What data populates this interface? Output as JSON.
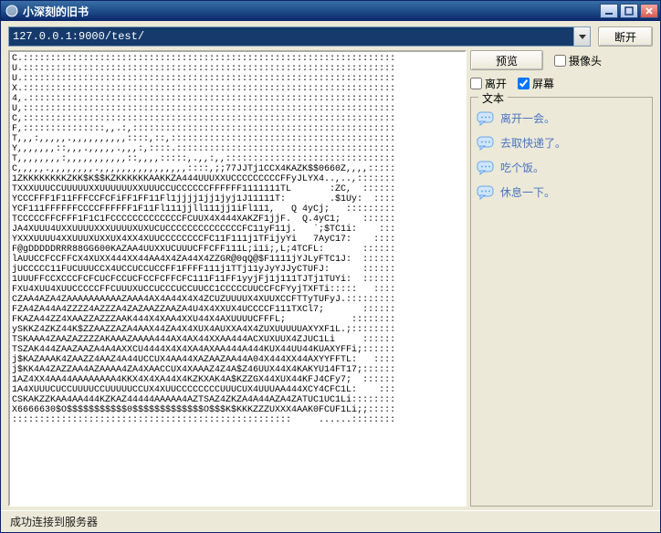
{
  "window": {
    "title": "小深刻的旧书"
  },
  "address": {
    "value": "127.0.0.1:9000/test/"
  },
  "buttons": {
    "disconnect": "断开",
    "preview": "预览"
  },
  "checkboxes": {
    "camera": "摄像头",
    "leave": "离开",
    "screen": "屏幕"
  },
  "checkbox_state": {
    "camera": false,
    "leave": false,
    "screen": true
  },
  "group": {
    "title": "文本"
  },
  "messages": [
    "离开一会。",
    "去取快递了。",
    "吃个饭。",
    "休息一下。"
  ],
  "ascii": "C.::::::::::::::::::::::::::::::::::::::::::::::::::::::::::::::::::::\nU.::::::::::::::::::::::::::::::::::::::::::::::::::::::::::::::::::::\nU.::::::::::::::::::::::::::::::::::::::::::::::::::::::::::::::::::::\nX.::::::::::::::::::::::::::::::::::::::::::::::::::::::::::::::::::::\n4,.:::::::::::::::::::::::::::::::::::::::::::::::::::::::::::::::::::\nU,::::::::::::::::::::::::::::::::::::::::::::::::::::::::::::::::::::\nC,::::::::::::::::::::::::::::::::::::::::::::::::::::::::::::::::::::\nF,:::::::::::::::,,.:,::::::::::::::::::::::::::::::::::::::::::::::::\nT,,,:,,,,,.,,,,,,,,,,::::,::,:::::::::::::::::::::::::::::::::::::::::\nY,,,,,,,::,,,.,,,,,.,,,:,::::.::::::::::::::::::::::::::::::::::::::::\nT,,,,,,,,:,,,,,,,,,,,::,,,,:::::,.,,:,,:::::::::::::::::::::::::::::::\nC,,,,,.,,,,,,,,.,,,,,,,,,,,,,,,,::::,;;77JJTj1CCX4KAZK$$0660Z,,,,:::::\n1ZKKKKKKKKZKK$K$$KZKKKKKKAAKKZA444UUUXXUCCCCCCCCCFFyJLYX4..,..,:::::::\nTXXXUUUCCUUUUUXXUUUUUUXXUUUCCUCCCCCCFFFFFF1111111TL       :ZC,  ::::::\nYCCCFFF1F11FFFCCFCFiFF1FF11Fl1jjjj1jj1jyj1J11111T:        .$1Uy:  ::::\nYCF111FFFFFFCCCCFFFFFF1F11Fl111jjll111jj1iFl111,   Q 4yCj;   :::::::::\nTCCCCCFFCFFF1F1C1FCCCCCCCCCCCCCFCUUX4X444XAKZF1jjF.  Q.4yC1;    ::::::\nJA4XUUU4UXXUUUUXXXUUUUXUXUCUCCCCCCCCCCCCCCFC11yF11j.   `;$TC1i:    :::\nYXXXUUUU4XXUUUXUXXUX4XX4XUUCCCCCCCCFC11F111j1TFijyYi   7AyC17:    ::::\nF@gDDDDDRRR88GG600KAZAA4UUXXUCUUUCFFCFF111L;i1i;,L;4TCFL:       ::::::\nlAUUCCFCCFFCX4XUXX444XX44AA4X4ZA44X4ZZGR@0qQ@$F1111jYJLyFTC1J:  ::::::\njUCCCCC11FUCUUUCCX4UCCUCCUCCFF1FFFF111j1TTj11yJyYJJyCTUFJ:      ::::::\n1UUUFFCCXCCCFCFCUCFCCUCFCCFCFFCFC111F11FF1yyjFj1j111TJTj1TUYi:  ::::::\nFXU4XUU4XUUCCCCCFFCUUUXUCCUCCCUCCUUCC1CCCCCUUCCFCFYyjTXFTi:::::   ::::\nCZAA4AZA4ZAAAAAAAAAAZAAA4AX4A44X4X4ZCUZUUUUX4XUUXCCFTTyTUFyJ.:::::::::\nFZA4ZA44A4ZZZZ4AZZZA4ZAZAAZZAAZA4U4X4XXUX4UCCCCF111TXCl7;       ::::::\nFKAZA44ZZ4XAAZZAZZZAAK444X4XAA4XXU44X4AXUUUUCFFFL;            ::::::::\nySKKZ4ZKZ44K$ZZAAZZAZA4AAX44ZA4X4XUX4AUXXA4X4ZUXUUUUUAXYXF1L.;::::::::\nTSKAAA4ZAAZAZZZZAKAAAZAAAA444AX4AX44XXAA444ACXUXUUX4ZJUC1Li     ::::::\nTSZAK444ZAAZAAZA4A4AXXCU4444X4X4XA4AXAA444A444KUX44UU44KUAXYFFi;::::::\nj$KAZAAAK4ZAAZZ4AAZ4A44UCCUX4AA44XAZAAZAA44A04X444XX44AXYYFFTL:   ::::\nj$KK4A4ZAZZAA4AZAAAA4ZA4XAACCUX4XAAAZ4Z4A$Z46UUX44X4KAKYU14FT17;::::::\n1AZ4XX4AA44AAAAAAAA4KKX4X4XA44X4KZKXAK4A$KZZGX44XUX44KFJ4CFy7;  ::::::\n1A4XUUUCUCCUUUUCCUUUUUCCUX4XUUCCCCCCCCUUUCUX4UUUAA444XCY4CFC1L:    :::\nCSKAKZZKAA4AA444KZKAZ44444AAAAA4AZTSAZ4ZKZA4A44AZA4ZATUC1UC1Li::::::::\nX6666630$O$$$$$$$$$$$0$$$$$$$$$$$$$O$$$K$KKKZZZUXXX4AAK0FCUF1Li;;:::::\n:::::::::::::::::::::::::::::::::::::::::::::::::::     ......::::::::",
  "status": "成功连接到服务器"
}
